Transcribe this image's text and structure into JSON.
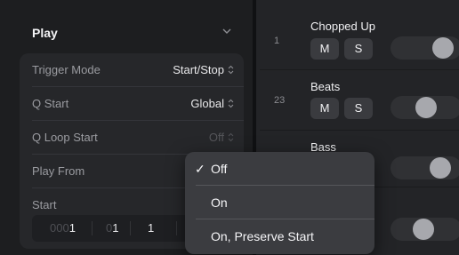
{
  "play_section": {
    "title": "Play",
    "params": [
      {
        "label": "Trigger Mode",
        "value": "Start/Stop"
      },
      {
        "label": "Q Start",
        "value": "Global"
      },
      {
        "label": "Q Loop Start",
        "value": "Off"
      },
      {
        "label": "Play From",
        "value": ""
      },
      {
        "label": "Start",
        "value": ""
      }
    ],
    "start_fields": [
      {
        "dim": "000",
        "value": "1"
      },
      {
        "dim": "0",
        "value": "1"
      },
      {
        "dim": "",
        "value": "1"
      }
    ]
  },
  "tracks": [
    {
      "number": "1",
      "name": "Chopped Up",
      "mute_label": "M",
      "solo_label": "S",
      "volume_level": 0.85
    },
    {
      "number": "23",
      "name": "Beats",
      "mute_label": "M",
      "solo_label": "S",
      "volume_level": 0.5
    },
    {
      "number": "",
      "name": "Bass",
      "volume_level": 0.8
    },
    {
      "number": "",
      "name": "",
      "volume_level": 0.45
    }
  ],
  "popup_menu": {
    "items": [
      {
        "label": "Off",
        "checked": true
      },
      {
        "label": "On",
        "checked": false
      },
      {
        "label": "On, Preserve Start",
        "checked": false
      }
    ],
    "check_glyph": "✓"
  },
  "icons": {
    "chevron": "chevron-down-icon",
    "stepper": "updown-icon",
    "check": "check-icon"
  }
}
